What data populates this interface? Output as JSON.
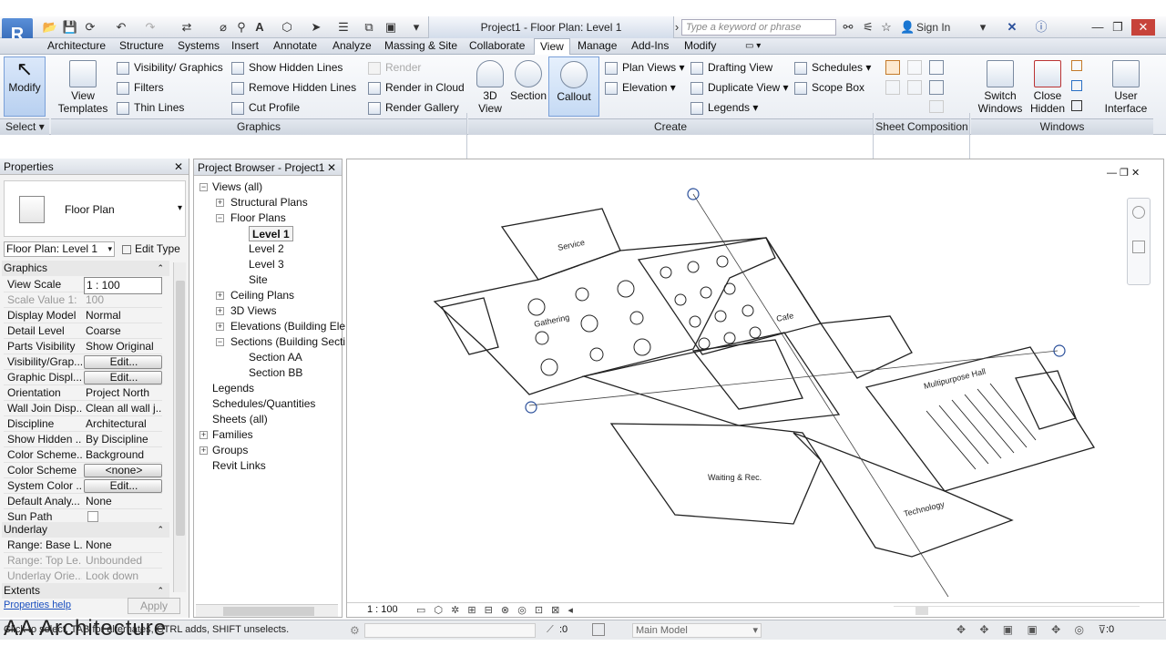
{
  "window": {
    "title": "Project1 - Floor Plan: Level 1",
    "search_placeholder": "Type a keyword or phrase",
    "sign_in": "Sign In"
  },
  "tabs": [
    "Architecture",
    "Structure",
    "Systems",
    "Insert",
    "Annotate",
    "Analyze",
    "Massing & Site",
    "Collaborate",
    "View",
    "Manage",
    "Add-Ins",
    "Modify"
  ],
  "active_tab": "View",
  "ribbon": {
    "modify": "Modify",
    "view_templates": "View Templates",
    "visibility_graphics": "Visibility/ Graphics",
    "filters": "Filters",
    "thin_lines": "Thin Lines",
    "show_hidden_lines": "Show  Hidden Lines",
    "remove_hidden_lines": "Remove  Hidden Lines",
    "cut_profile": "Cut  Profile",
    "render": "Render",
    "render_in_cloud": "Render  in Cloud",
    "render_gallery": "Render  Gallery",
    "view_3d": "3D View",
    "section": "Section",
    "callout": "Callout",
    "plan_views": "Plan  Views",
    "elevation": "Elevation",
    "drafting_view": "Drafting  View",
    "duplicate_view": "Duplicate  View",
    "legends": "Legends",
    "schedules": "Schedules",
    "scope_box": "Scope  Box",
    "switch_windows": "Switch Windows",
    "close_hidden": "Close Hidden",
    "user_interface": "User Interface",
    "panels": {
      "select": "Select",
      "graphics": "Graphics",
      "create": "Create",
      "sheet_composition": "Sheet Composition",
      "windows": "Windows"
    }
  },
  "properties": {
    "title": "Properties",
    "type": "Floor Plan",
    "selector": "Floor Plan: Level 1",
    "edit_type": "Edit Type",
    "group_graphics": "Graphics",
    "rows": [
      {
        "k": "View Scale",
        "v": "1 : 100"
      },
      {
        "k": "Scale Value    1:",
        "v": "100"
      },
      {
        "k": "Display Model",
        "v": "Normal"
      },
      {
        "k": "Detail Level",
        "v": "Coarse"
      },
      {
        "k": "Parts Visibility",
        "v": "Show Original"
      },
      {
        "k": "Visibility/Grap...",
        "v": "Edit..."
      },
      {
        "k": "Graphic Displ...",
        "v": "Edit..."
      },
      {
        "k": "Orientation",
        "v": "Project North"
      },
      {
        "k": "Wall Join Disp...",
        "v": "Clean all wall j..."
      },
      {
        "k": "Discipline",
        "v": "Architectural"
      },
      {
        "k": "Show Hidden ...",
        "v": "By Discipline"
      },
      {
        "k": "Color Scheme...",
        "v": "Background"
      },
      {
        "k": "Color Scheme",
        "v": "<none>"
      },
      {
        "k": "System Color ...",
        "v": "Edit..."
      },
      {
        "k": "Default Analy...",
        "v": "None"
      },
      {
        "k": "Sun Path",
        "v": ""
      }
    ],
    "group_underlay": "Underlay",
    "underlay_rows": [
      {
        "k": "Range: Base L...",
        "v": "None"
      },
      {
        "k": "Range: Top Le...",
        "v": "Unbounded"
      },
      {
        "k": "Underlay Orie...",
        "v": "Look down"
      }
    ],
    "group_extents": "Extents",
    "help": "Properties help",
    "apply": "Apply"
  },
  "browser": {
    "title": "Project Browser - Project1",
    "items": [
      "Views (all)",
      "Structural Plans",
      "Floor Plans",
      "Level 1",
      "Level 2",
      "Level 3",
      "Site",
      "Ceiling Plans",
      "3D Views",
      "Elevations (Building Ele",
      "Sections (Building Secti",
      "Section AA",
      "Section BB",
      "Legends",
      "Schedules/Quantities",
      "Sheets (all)",
      "Families",
      "Groups",
      "Revit Links"
    ]
  },
  "canvas": {
    "rooms": [
      "Service",
      "Gathering",
      "Cafe",
      "Multipurpose Hall",
      "Waiting & Rec.",
      "Technology"
    ],
    "scale": "1 : 100"
  },
  "status": {
    "hint": "Click to select, TAB for alternates, CTRL adds, SHIFT unselects.",
    "count": ":0",
    "model": "Main Model",
    "watermark": "AA Architecture"
  }
}
